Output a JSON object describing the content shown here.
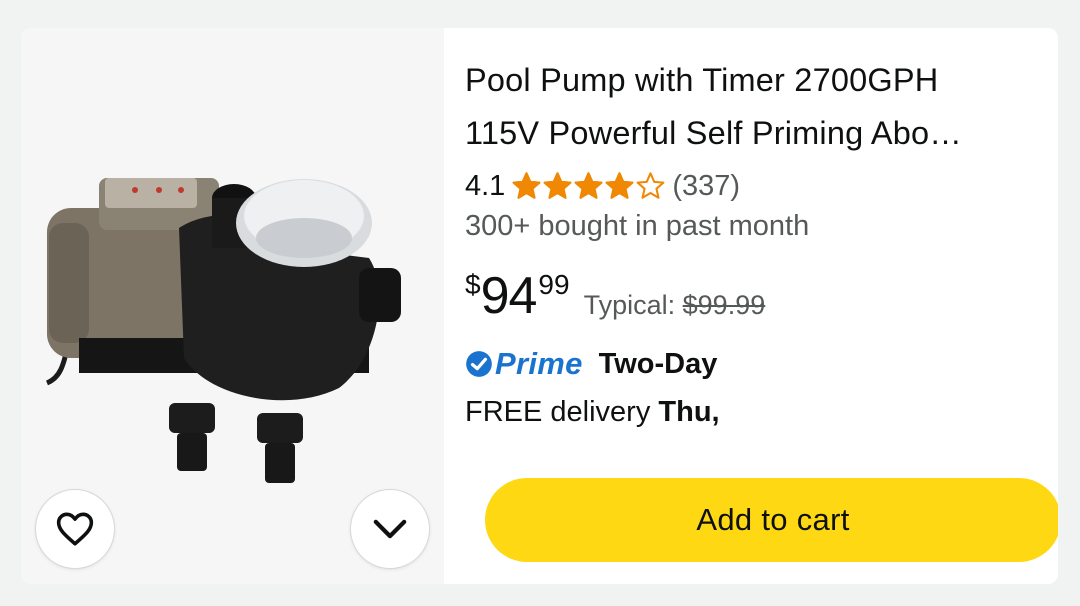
{
  "product": {
    "title_line1": "Pool Pump with Timer 2700GPH",
    "title_line2": "115V Powerful Self Priming Abo…",
    "rating": "4.1",
    "stars": 4.1,
    "review_count": "(337)",
    "bought": "300+ bought in past month",
    "price": {
      "symbol": "$",
      "whole": "94",
      "fraction": "99",
      "typical_label": "Typical:",
      "typical_price": "$99.99"
    },
    "prime": {
      "label": "Prime",
      "speed": "Two-Day"
    },
    "delivery": {
      "prefix": "FREE delivery",
      "day": "Thu,"
    },
    "add_to_cart": "Add to cart"
  },
  "icons": {
    "favorite": "heart-icon",
    "more": "chevron-down-icon",
    "prime_check": "check-circle-icon",
    "star": "star-icon"
  },
  "colors": {
    "star": "#f08804",
    "prime_blue": "#1a74cf",
    "cart_button": "#ffd814",
    "text_primary": "#0f1111",
    "text_secondary": "#565959"
  }
}
